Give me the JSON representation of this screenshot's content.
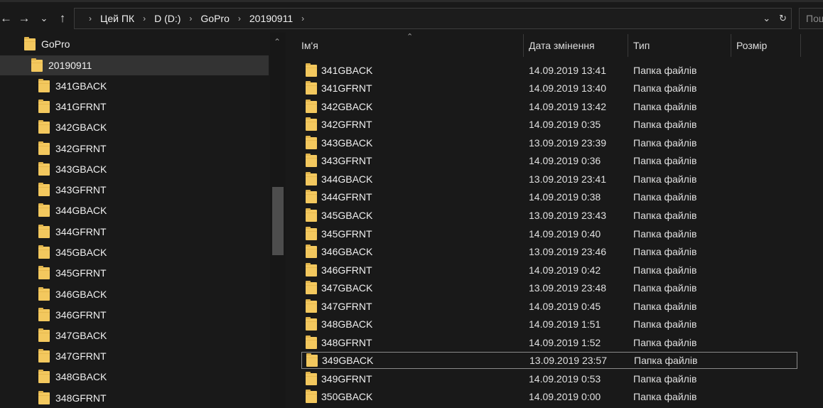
{
  "window": {
    "nav": {
      "back": "←",
      "forward": "→",
      "recent": "⌄",
      "up": "↑"
    },
    "breadcrumbs": [
      "Цей ПК",
      "D (D:)",
      "GoPro",
      "20190911"
    ],
    "search_placeholder": "Пош"
  },
  "navpane": {
    "items": [
      {
        "label": "GoPro",
        "indent": 0
      },
      {
        "label": "20190911",
        "indent": 1,
        "selected": true
      },
      {
        "label": "341GBACK",
        "indent": 2
      },
      {
        "label": "341GFRNT",
        "indent": 2
      },
      {
        "label": "342GBACK",
        "indent": 2
      },
      {
        "label": "342GFRNT",
        "indent": 2
      },
      {
        "label": "343GBACK",
        "indent": 2
      },
      {
        "label": "343GFRNT",
        "indent": 2
      },
      {
        "label": "344GBACK",
        "indent": 2
      },
      {
        "label": "344GFRNT",
        "indent": 2
      },
      {
        "label": "345GBACK",
        "indent": 2
      },
      {
        "label": "345GFRNT",
        "indent": 2
      },
      {
        "label": "346GBACK",
        "indent": 2
      },
      {
        "label": "346GFRNT",
        "indent": 2
      },
      {
        "label": "347GBACK",
        "indent": 2
      },
      {
        "label": "347GFRNT",
        "indent": 2
      },
      {
        "label": "348GBACK",
        "indent": 2
      },
      {
        "label": "348GFRNT",
        "indent": 2
      }
    ]
  },
  "filelist": {
    "columns": {
      "name": "Ім'я",
      "date": "Дата змінення",
      "type": "Тип",
      "size": "Розмір"
    },
    "rows": [
      {
        "name": "341GBACK",
        "date": "14.09.2019 13:41",
        "type": "Папка файлів"
      },
      {
        "name": "341GFRNT",
        "date": "14.09.2019 13:40",
        "type": "Папка файлів"
      },
      {
        "name": "342GBACK",
        "date": "14.09.2019 13:42",
        "type": "Папка файлів"
      },
      {
        "name": "342GFRNT",
        "date": "14.09.2019 0:35",
        "type": "Папка файлів"
      },
      {
        "name": "343GBACK",
        "date": "13.09.2019 23:39",
        "type": "Папка файлів"
      },
      {
        "name": "343GFRNT",
        "date": "14.09.2019 0:36",
        "type": "Папка файлів"
      },
      {
        "name": "344GBACK",
        "date": "13.09.2019 23:41",
        "type": "Папка файлів"
      },
      {
        "name": "344GFRNT",
        "date": "14.09.2019 0:38",
        "type": "Папка файлів"
      },
      {
        "name": "345GBACK",
        "date": "13.09.2019 23:43",
        "type": "Папка файлів"
      },
      {
        "name": "345GFRNT",
        "date": "14.09.2019 0:40",
        "type": "Папка файлів"
      },
      {
        "name": "346GBACK",
        "date": "13.09.2019 23:46",
        "type": "Папка файлів"
      },
      {
        "name": "346GFRNT",
        "date": "14.09.2019 0:42",
        "type": "Папка файлів"
      },
      {
        "name": "347GBACK",
        "date": "13.09.2019 23:48",
        "type": "Папка файлів"
      },
      {
        "name": "347GFRNT",
        "date": "14.09.2019 0:45",
        "type": "Папка файлів"
      },
      {
        "name": "348GBACK",
        "date": "14.09.2019 1:51",
        "type": "Папка файлів"
      },
      {
        "name": "348GFRNT",
        "date": "14.09.2019 1:52",
        "type": "Папка файлів"
      },
      {
        "name": "349GBACK",
        "date": "13.09.2019 23:57",
        "type": "Папка файлів",
        "focused": true
      },
      {
        "name": "349GFRNT",
        "date": "14.09.2019 0:53",
        "type": "Папка файлів"
      },
      {
        "name": "350GBACK",
        "date": "14.09.2019 0:00",
        "type": "Папка файлів"
      }
    ]
  },
  "colors": {
    "background": "#191919",
    "folder": "#f3c85e",
    "selection": "#333333",
    "text": "#f0f0f0"
  }
}
